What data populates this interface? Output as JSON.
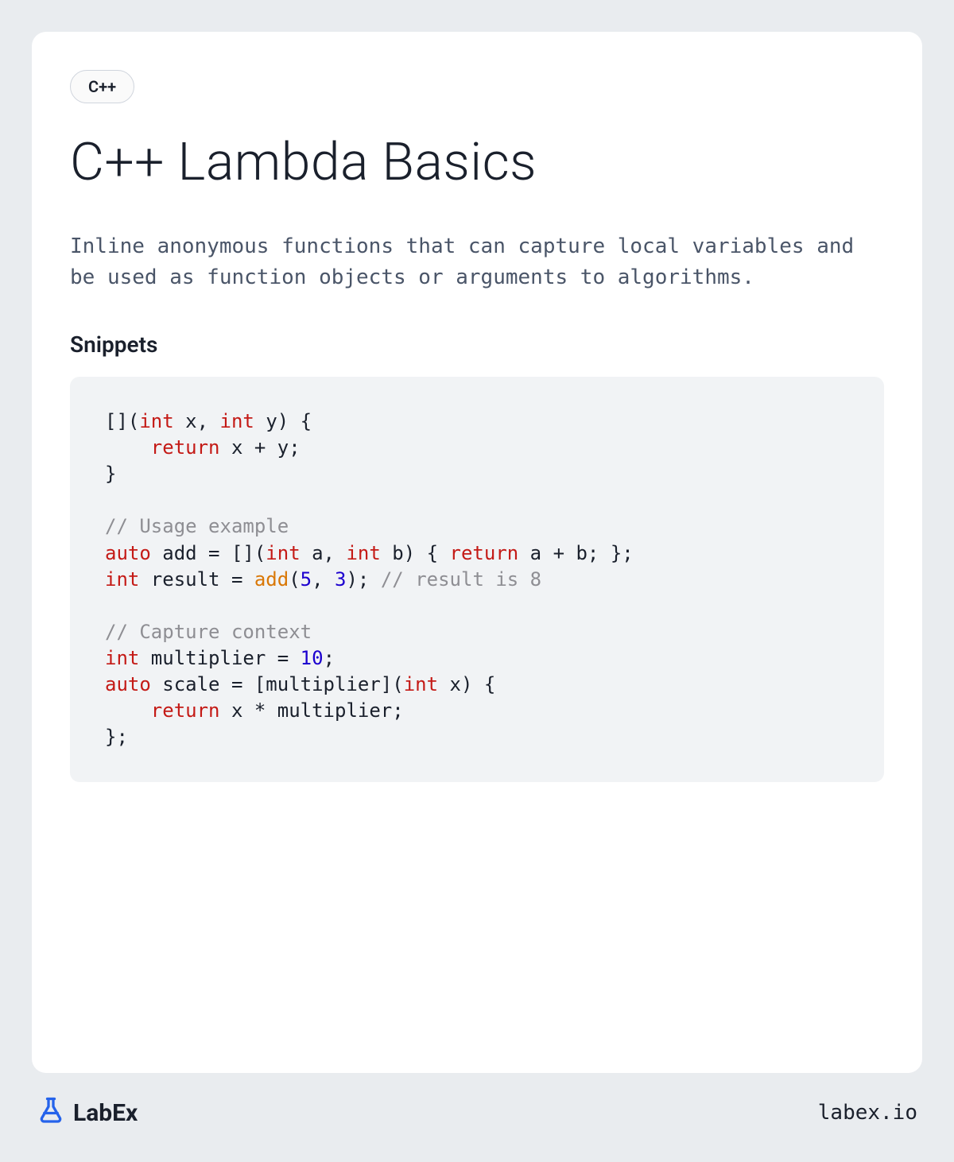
{
  "tag": "C++",
  "title": "C++ Lambda Basics",
  "description": "Inline anonymous functions that can capture local variables and be used as function objects or arguments to algorithms.",
  "snippets_heading": "Snippets",
  "code": {
    "l1a": "[](",
    "l1_int1": "int",
    "l1b": " x, ",
    "l1_int2": "int",
    "l1c": " y) {",
    "l2a": "    ",
    "l2_ret": "return",
    "l2b": " x + y;",
    "l3": "}",
    "l5_cm": "// Usage example",
    "l6_auto": "auto",
    "l6a": " add = [](",
    "l6_int1": "int",
    "l6b": " a, ",
    "l6_int2": "int",
    "l6c": " b) { ",
    "l6_ret": "return",
    "l6d": " a + b; };",
    "l7_int": "int",
    "l7a": " result = ",
    "l7_fn": "add",
    "l7b": "(",
    "l7_n1": "5",
    "l7c": ", ",
    "l7_n2": "3",
    "l7d": "); ",
    "l7_cm": "// result is 8",
    "l9_cm": "// Capture context",
    "l10_int": "int",
    "l10a": " multiplier = ",
    "l10_n": "10",
    "l10b": ";",
    "l11_auto": "auto",
    "l11a": " scale = [multiplier](",
    "l11_int": "int",
    "l11b": " x) {",
    "l12a": "    ",
    "l12_ret": "return",
    "l12b": " x * multiplier;",
    "l13": "};"
  },
  "brand": "LabEx",
  "site": "labex.io"
}
